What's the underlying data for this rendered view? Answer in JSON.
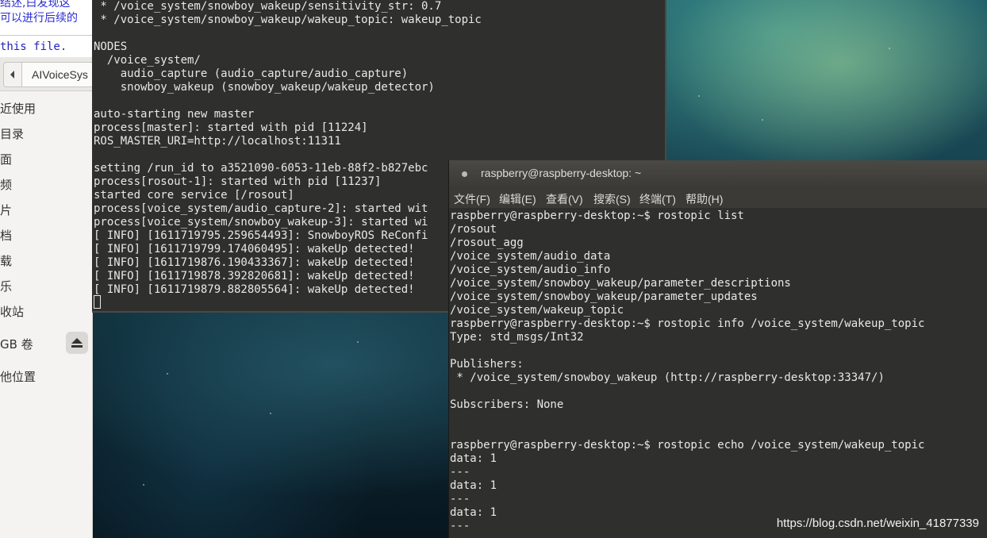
{
  "doc": {
    "line1": "结述,白发现这",
    "line2": "可以进行后续的",
    "line3": "this file."
  },
  "file_manager": {
    "path_label": "AIVoiceSys",
    "items": [
      {
        "label": "近使用"
      },
      {
        "label": "目录"
      },
      {
        "label": "面"
      },
      {
        "label": "频"
      },
      {
        "label": "片"
      },
      {
        "label": "档"
      },
      {
        "label": "载"
      },
      {
        "label": "乐"
      },
      {
        "label": "收站"
      },
      {
        "label": "GB 卷"
      },
      {
        "label": "他位置"
      }
    ]
  },
  "terminal_back": {
    "lines": [
      " * /voice_system/snowboy_wakeup/sensitivity_str: 0.7",
      " * /voice_system/snowboy_wakeup/wakeup_topic: wakeup_topic",
      "",
      "NODES",
      "  /voice_system/",
      "    audio_capture (audio_capture/audio_capture)",
      "    snowboy_wakeup (snowboy_wakeup/wakeup_detector)",
      "",
      "auto-starting new master",
      "process[master]: started with pid [11224]",
      "ROS_MASTER_URI=http://localhost:11311",
      "",
      "setting /run_id to a3521090-6053-11eb-88f2-b827ebc",
      "process[rosout-1]: started with pid [11237]",
      "started core service [/rosout]",
      "process[voice_system/audio_capture-2]: started wit",
      "process[voice_system/snowboy_wakeup-3]: started wi",
      "[ INFO] [1611719795.259654493]: SnowboyROS ReConfi",
      "[ INFO] [1611719799.174060495]: wakeUp detected!",
      "[ INFO] [1611719876.190433367]: wakeUp detected!",
      "[ INFO] [1611719878.392820681]: wakeUp detected!",
      "[ INFO] [1611719879.882805564]: wakeUp detected!"
    ]
  },
  "terminal_front": {
    "title": "raspberry@raspberry-desktop: ~",
    "menu": [
      {
        "label": "文件(F)"
      },
      {
        "label": "编辑(E)"
      },
      {
        "label": "查看(V)"
      },
      {
        "label": "搜索(S)"
      },
      {
        "label": "终端(T)"
      },
      {
        "label": "帮助(H)"
      }
    ],
    "lines": [
      "raspberry@raspberry-desktop:~$ rostopic list",
      "/rosout",
      "/rosout_agg",
      "/voice_system/audio_data",
      "/voice_system/audio_info",
      "/voice_system/snowboy_wakeup/parameter_descriptions",
      "/voice_system/snowboy_wakeup/parameter_updates",
      "/voice_system/wakeup_topic",
      "raspberry@raspberry-desktop:~$ rostopic info /voice_system/wakeup_topic",
      "Type: std_msgs/Int32",
      "",
      "Publishers:",
      " * /voice_system/snowboy_wakeup (http://raspberry-desktop:33347/)",
      "",
      "Subscribers: None",
      "",
      "",
      "raspberry@raspberry-desktop:~$ rostopic echo /voice_system/wakeup_topic",
      "data: 1",
      "---",
      "data: 1",
      "---",
      "data: 1",
      "---"
    ]
  },
  "watermark": "https://blog.csdn.net/weixin_41877339"
}
